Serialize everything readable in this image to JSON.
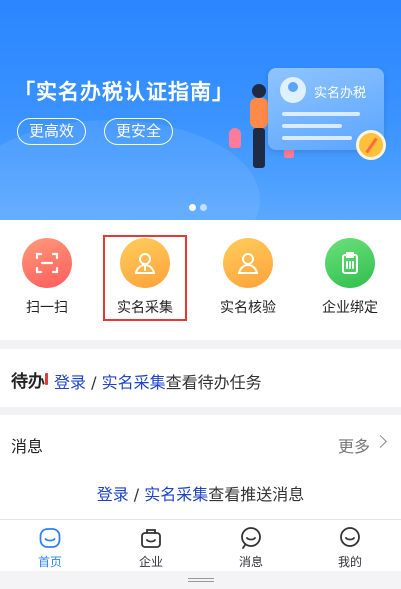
{
  "banner": {
    "title": "「实名办税认证指南」",
    "tags": [
      "更高效",
      "更安全"
    ],
    "card_text": "实名办税",
    "carousel_pages": 2,
    "carousel_active": 0
  },
  "actions": [
    {
      "label": "扫一扫",
      "icon": "scan-icon",
      "color": "#ff6b5e"
    },
    {
      "label": "实名采集",
      "icon": "user-icon",
      "color": "#ffb347"
    },
    {
      "label": "实名核验",
      "icon": "user-icon",
      "color": "#ffb347"
    },
    {
      "label": "企业绑定",
      "icon": "clipboard-icon",
      "color": "#3ccf5a"
    }
  ],
  "todo": {
    "label": "待办",
    "login_link": "登录",
    "separator": " / ",
    "collect_link": "实名采集",
    "suffix": "查看待办任务"
  },
  "messages": {
    "title": "消息",
    "more": "更多",
    "login_link": "登录",
    "separator": " / ",
    "collect_link": "实名采集",
    "suffix": "查看推送消息"
  },
  "tabs": [
    {
      "label": "首页",
      "icon": "home-icon",
      "active": true
    },
    {
      "label": "企业",
      "icon": "enterprise-icon",
      "active": false
    },
    {
      "label": "消息",
      "icon": "message-icon",
      "active": false
    },
    {
      "label": "我的",
      "icon": "profile-icon",
      "active": false
    }
  ],
  "colors": {
    "primary": "#2f80ff",
    "link": "#2044c8",
    "highlight": "#e53935"
  }
}
